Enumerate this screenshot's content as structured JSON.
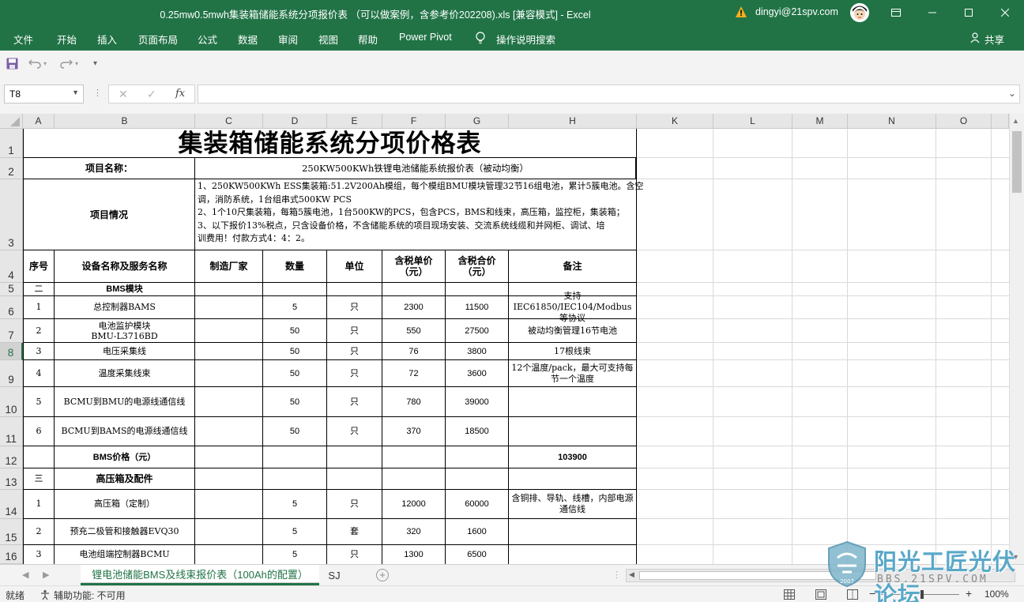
{
  "window": {
    "title": "0.25mw0.5mwh集装箱储能系统分项报价表 （可以做案例，含参考价202208).xls  [兼容模式]  -  Excel",
    "user": "dingyi@21spv.com",
    "minimize_icon": "minimize-icon",
    "restore_icon": "restore-icon",
    "close_icon": "close-icon"
  },
  "ribbon": {
    "tabs": [
      "文件",
      "开始",
      "插入",
      "页面布局",
      "公式",
      "数据",
      "审阅",
      "视图",
      "帮助",
      "Power Pivot",
      "操作说明搜索"
    ],
    "share": "共享"
  },
  "formula_bar": {
    "name_box": "T8",
    "fx": "fx",
    "value": ""
  },
  "columns": [
    "A",
    "B",
    "C",
    "D",
    "E",
    "F",
    "G",
    "H",
    "K",
    "L",
    "M",
    "N",
    "O"
  ],
  "rows": [
    "1",
    "2",
    "3",
    "4",
    "5",
    "6",
    "7",
    "8",
    "9",
    "10",
    "11",
    "12",
    "13",
    "14",
    "15",
    "16"
  ],
  "sheet": {
    "title": "集装箱储能系统分项价格表",
    "project_name_label": "项目名称：",
    "project_name_value": "250KW500KWh铁锂电池储能系统报价表（被动均衡）",
    "project_info_label": "项目情况",
    "project_info_lines": [
      "1、250KW500KWh ESS集装箱:51.2V200Ah模组，每个模组BMU模块管理32节16组电池，累计5簇电池。含空",
      "调，消防系统，1台组串式500KW PCS",
      "2、1个10尺集装箱，每箱5簇电池，1台500KW的PCS，包含PCS，BMS和线束，高压箱，监控柜，集装箱；",
      "3、以下报价13%税点，只含设备价格，不含储能系统的项目现场安装、交流系统线缆和并网柜、调试、培",
      "训费用！付款方式4：4：2。"
    ],
    "headers": [
      "序号",
      "设备名称及服务名称",
      "制造厂家",
      "数量",
      "单位",
      "含税单价\n（元）",
      "含税合价\n（元）",
      "备注"
    ],
    "section_bms": {
      "no": "二",
      "name": "BMS模块"
    },
    "bms_rows": [
      {
        "no": "1",
        "name": "总控制器BAMS",
        "qty": "5",
        "unit": "只",
        "price": "2300",
        "total": "11500",
        "note": "支持IEC61850/IEC104/Modbus等协议"
      },
      {
        "no": "2",
        "name": "电池监护模块\nBMU-L3716BD",
        "qty": "50",
        "unit": "只",
        "price": "550",
        "total": "27500",
        "note": "被动均衡管理16节电池"
      },
      {
        "no": "3",
        "name": "电压采集线",
        "qty": "50",
        "unit": "只",
        "price": "76",
        "total": "3800",
        "note": "17根线束"
      },
      {
        "no": "4",
        "name": "温度采集线束",
        "qty": "50",
        "unit": "只",
        "price": "72",
        "total": "3600",
        "note": "12个温度/pack，最大可支持每节一个温度"
      },
      {
        "no": "5",
        "name": "BCMU到BMU的电源线通信线",
        "qty": "50",
        "unit": "只",
        "price": "780",
        "total": "39000",
        "note": ""
      },
      {
        "no": "6",
        "name": "BCMU到BAMS的电源线通信线",
        "qty": "50",
        "unit": "只",
        "price": "370",
        "total": "18500",
        "note": ""
      }
    ],
    "bms_price_label": "BMS价格（元）",
    "bms_price_value": "103900",
    "section_hv": {
      "no": "三",
      "name": "高压箱及配件"
    },
    "hv_rows": [
      {
        "no": "1",
        "name": "高压箱（定制）",
        "qty": "5",
        "unit": "只",
        "price": "12000",
        "total": "60000",
        "note": "含铜排、导轨、线槽，内部电源通信线"
      },
      {
        "no": "2",
        "name": "预充二极管和接触器EVQ30",
        "qty": "5",
        "unit": "套",
        "price": "320",
        "total": "1600",
        "note": ""
      },
      {
        "no": "3",
        "name": "电池组端控制器BCMU",
        "qty": "5",
        "unit": "只",
        "price": "1300",
        "total": "6500",
        "note": ""
      }
    ]
  },
  "sheet_tabs": [
    "锂电池储能BMS及线束报价表（100Ah的配置）",
    "SJ"
  ],
  "status": {
    "ready": "就绪",
    "accessibility": "辅助功能: 不可用",
    "zoom": "100%"
  },
  "watermark": {
    "text": "阳光工匠光伏论坛",
    "url": "BBS.21SPV.COM",
    "year": "2007"
  },
  "colors": {
    "accent": "#217346"
  }
}
